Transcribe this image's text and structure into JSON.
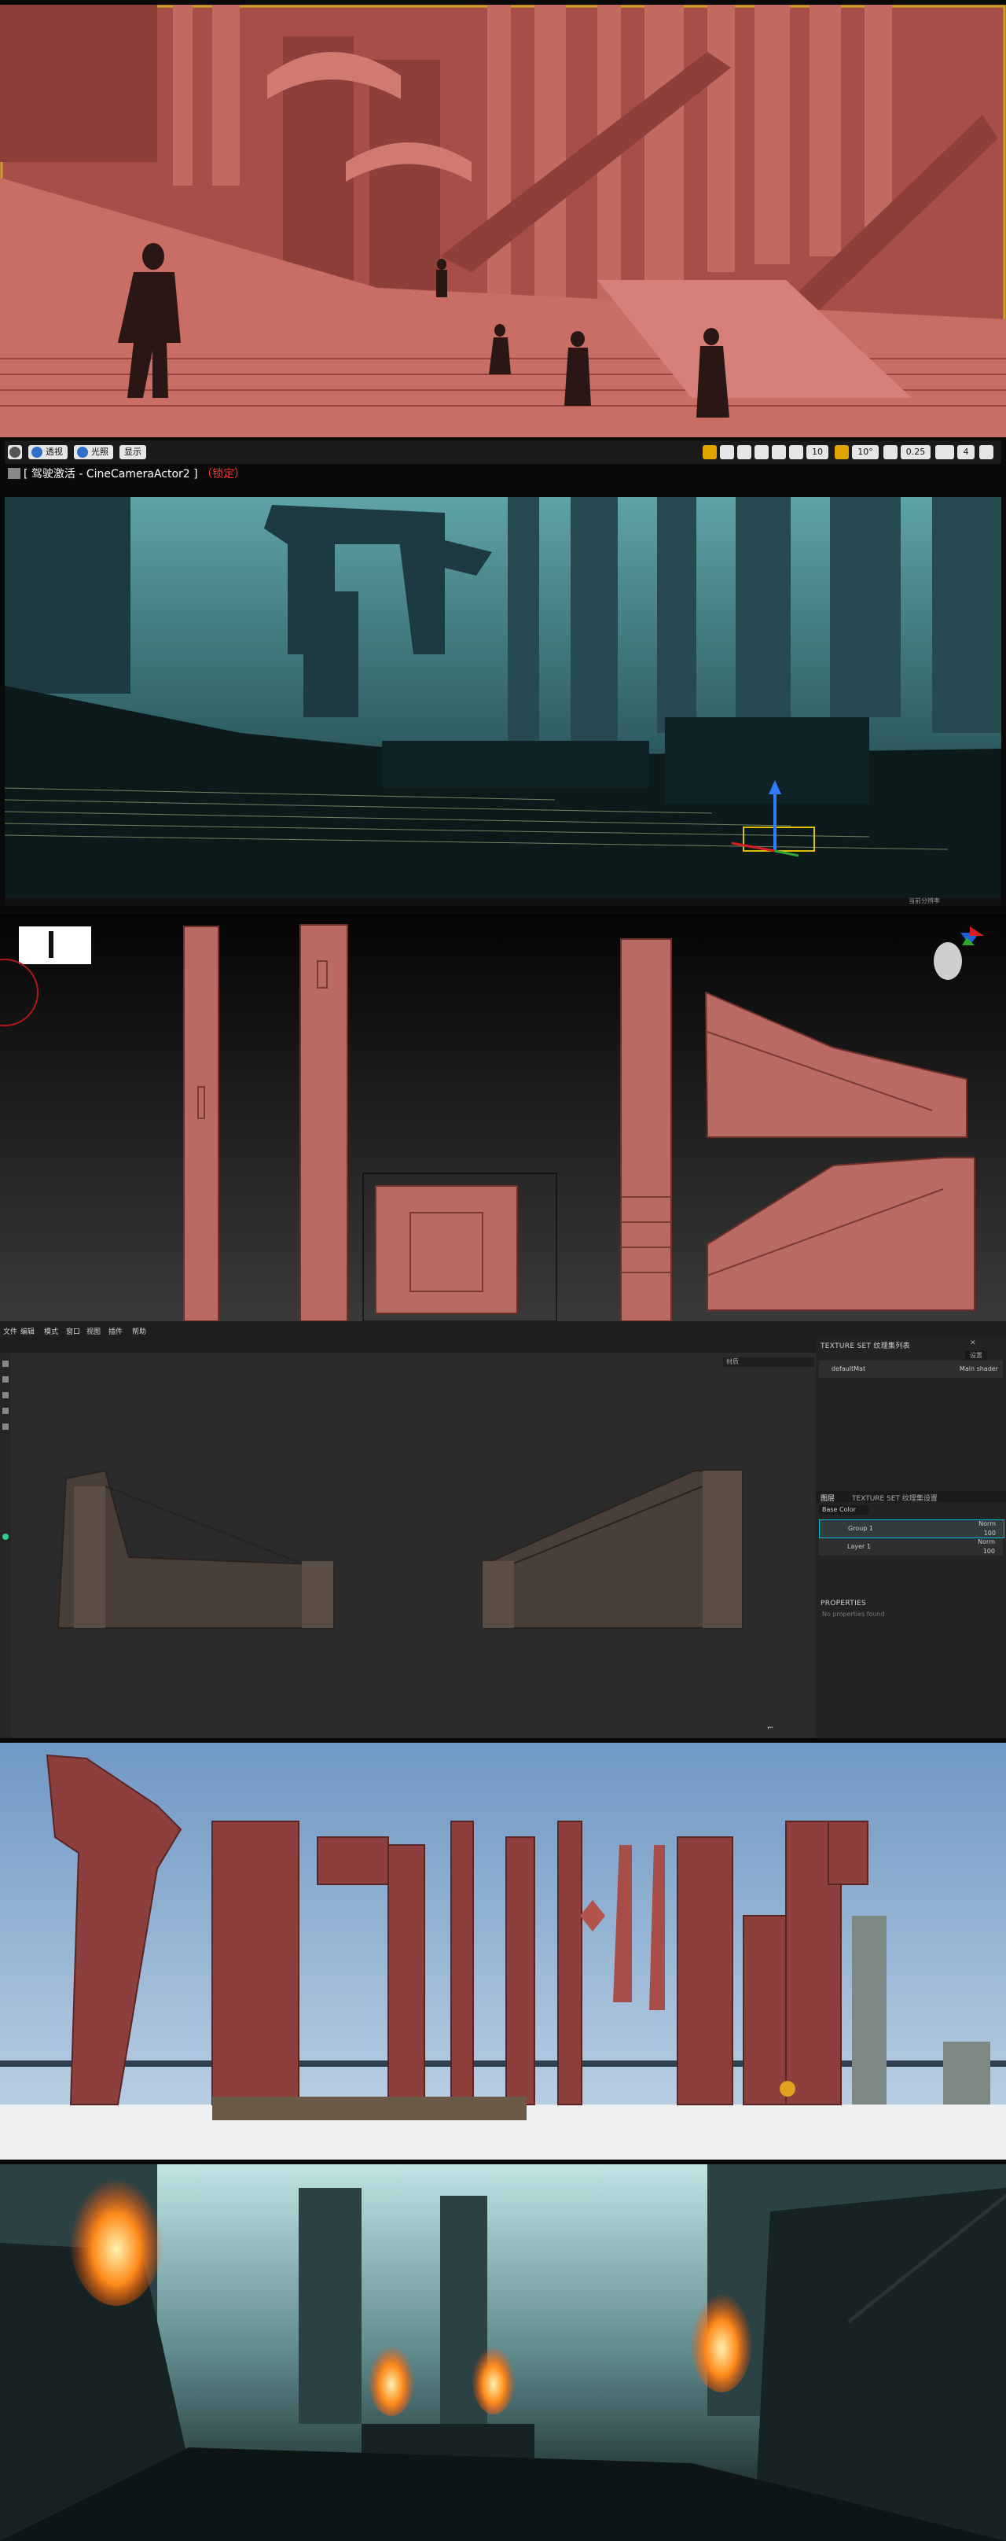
{
  "viewport": {
    "toolbar": {
      "perspective_label": "透视",
      "lit_label": "光照",
      "show_label": "显示",
      "grid_value": "10",
      "rotation_value": "10°",
      "scale_value": "0.25",
      "camera_speed": "4"
    },
    "pilot": {
      "prefix": "[ 驾驶激活 - CineCameraActor2 ]",
      "lock_label": "（锁定）"
    },
    "status_text": "当前分辨率"
  },
  "painter": {
    "menu_items": [
      "文件",
      "编辑",
      "模式",
      "窗口",
      "视图",
      "插件",
      "帮助"
    ],
    "viewport_mode": "材质",
    "texture_set_list_title": "TEXTURE SET 纹理集列表",
    "texture_set_list_button": "设置",
    "texture_set_name": "defaultMat",
    "texture_set_shader": "Main shader",
    "layers_tab": "图层",
    "texture_set_settings_tab": "TEXTURE SET 纹理集设置",
    "channel_select": "Base Color",
    "layers": [
      {
        "name": "Group 1",
        "blend": "Norm",
        "opacity": "100"
      },
      {
        "name": "Layer 1",
        "blend": "Norm",
        "opacity": "100"
      }
    ],
    "properties_title": "PROPERTIES",
    "properties_empty": "No properties found"
  },
  "colors": {
    "selection_border": "#c9a227",
    "clay_red": "#b25a52",
    "sky_blue": "#8fb3d6",
    "teal_fog": "#3f7b80",
    "accent_cyan": "#00b8d4"
  }
}
